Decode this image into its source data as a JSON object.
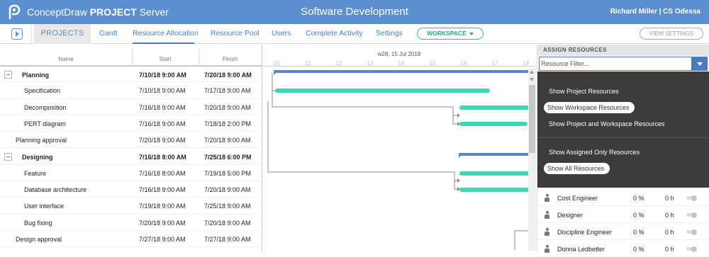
{
  "app": {
    "brand_normal": "ConceptDraw ",
    "brand_bold": "PROJECT",
    "brand_suffix": " Server"
  },
  "project_title": "Software Development",
  "user": "Richard Miller | CS Odessa",
  "nav": {
    "projects": "PROJECTS",
    "items": [
      "Gantt",
      "Resource Allocation",
      "Resource Pool",
      "Users",
      "Complete Activity",
      "Settings"
    ],
    "active": "Resource Allocation",
    "workspace": "WORKSPACE",
    "view_settings": "VIEW SETTINGS"
  },
  "grid": {
    "headers": {
      "name": "Name",
      "start": "Start",
      "finish": "Finish"
    },
    "rows": [
      {
        "name": "Planning",
        "start": "7/10/18 9:00 AM",
        "finish": "7/20/18 9:00 AM",
        "summary": true
      },
      {
        "name": "Specification",
        "start": "7/10/18 9:00 AM",
        "finish": "7/17/18 9:00 AM",
        "summary": false
      },
      {
        "name": "Decomposition",
        "start": "7/16/18 9:00 AM",
        "finish": "7/20/18 9:00 AM",
        "summary": false
      },
      {
        "name": "PERT diagram",
        "start": "7/16/18 9:00 AM",
        "finish": "7/18/18 2:00 PM",
        "summary": false
      },
      {
        "name": "Planning approval",
        "start": "7/20/18 9:00 AM",
        "finish": "7/20/18 9:00 AM",
        "summary": false
      },
      {
        "name": "Designing",
        "start": "7/16/18 8:00 AM",
        "finish": "7/25/18 6:00 PM",
        "summary": true
      },
      {
        "name": "Feature",
        "start": "7/16/18 8:00 AM",
        "finish": "7/19/18 5:00 PM",
        "summary": false
      },
      {
        "name": "Database architecture",
        "start": "7/16/18 9:00 AM",
        "finish": "7/20/18 9:00 AM",
        "summary": false
      },
      {
        "name": "User interface",
        "start": "7/19/18 9:00 AM",
        "finish": "7/25/18 9:00 AM",
        "summary": false
      },
      {
        "name": "Bug fixing",
        "start": "7/20/18 9:00 AM",
        "finish": "7/20/18 9:00 AM",
        "summary": false
      },
      {
        "name": "Design approval",
        "start": "7/27/18 9:00 AM",
        "finish": "7/27/18 9:00 AM",
        "summary": false
      }
    ]
  },
  "gantt": {
    "week_label": "w28, 15 Jul 2018",
    "day_labels": [
      "10",
      "11",
      "12",
      "13",
      "14",
      "15",
      "16",
      "17",
      "18"
    ]
  },
  "assign": {
    "header": "ASSIGN RESOURCES",
    "filter_placeholder": "Resource Filter...",
    "menu": [
      "Show Project Resources",
      "Show Workspace Resources",
      "Show Project and Workspace Resources",
      "Show Assigned Only Resources",
      "Show All Resources"
    ],
    "resources": [
      {
        "name": "Cost Engineer",
        "pct": "0 %",
        "hours": "0 h"
      },
      {
        "name": "Designer",
        "pct": "0 %",
        "hours": "0 h"
      },
      {
        "name": "Discipline Engineer",
        "pct": "0 %",
        "hours": "0 h"
      },
      {
        "name": "Donna Ledbetter",
        "pct": "0 %",
        "hours": "0 h"
      }
    ]
  },
  "colors": {
    "topbar": "#5b8fd0",
    "task_bar": "#3fd6b6",
    "summary_bar": "#5a87c8",
    "accent": "#4a7dbf"
  }
}
